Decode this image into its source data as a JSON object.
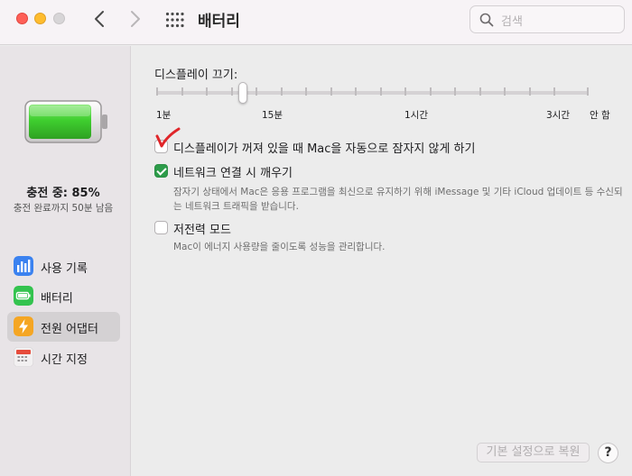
{
  "window": {
    "title": "배터리"
  },
  "search": {
    "placeholder": "검색"
  },
  "sidebar": {
    "charge_status": "충전 중: 85%",
    "charge_remaining": "충전 완료까지 50분 남음",
    "battery_level_percent": 85,
    "items": [
      {
        "label": "사용 기록",
        "icon": "usage-history-icon",
        "active": false
      },
      {
        "label": "배터리",
        "icon": "battery-icon",
        "active": false
      },
      {
        "label": "전원 어댑터",
        "icon": "power-adapter-icon",
        "active": true
      },
      {
        "label": "시간 지정",
        "icon": "schedule-icon",
        "active": false
      }
    ]
  },
  "main": {
    "display_off_label": "디스플레이 끄기:",
    "slider": {
      "ticks": [
        "1분",
        "15분",
        "1시간",
        "3시간",
        "안 함"
      ],
      "selected": "15분"
    },
    "options": [
      {
        "label": "디스플레이가 꺼져 있을 때 Mac을 자동으로 잠자지 않게 하기",
        "checked": false,
        "desc": ""
      },
      {
        "label": "네트워크 연결 시 깨우기",
        "checked": true,
        "desc": "잠자기 상태에서 Mac은 응용 프로그램을 최신으로 유지하기 위해 iMessage 및 기타 iCloud 업데이트 등 수신되는 네트워크 트래픽을 받습니다."
      },
      {
        "label": "저전력 모드",
        "checked": false,
        "desc": "Mac이 에너지 사용량을 줄이도록 성능을 관리합니다."
      }
    ]
  },
  "footer": {
    "reset_label": "기본 설정으로 복원",
    "help_label": "?"
  },
  "colors": {
    "accent_green": "#2d9c4a",
    "annotation_red": "#e0262a",
    "battery_green": "#3fcf2f"
  }
}
